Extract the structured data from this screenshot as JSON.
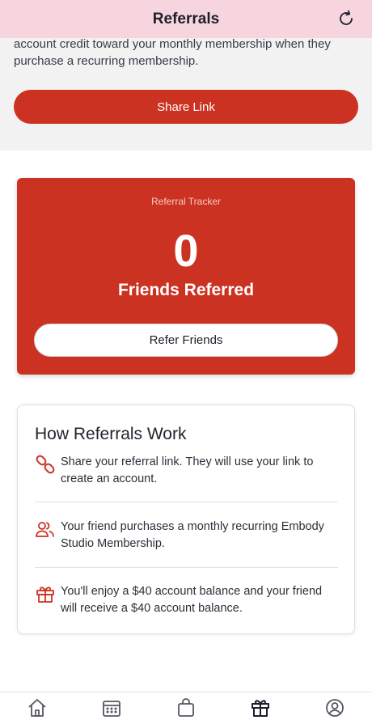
{
  "header": {
    "title": "Referrals"
  },
  "intro": {
    "text": "account credit toward your monthly membership when they purchase a recurring membership.",
    "share_label": "Share Link"
  },
  "tracker": {
    "label": "Referral Tracker",
    "count": "0",
    "count_label": "Friends Referred",
    "refer_label": "Refer Friends"
  },
  "how": {
    "title": "How Referrals Work",
    "steps": [
      {
        "icon": "link-icon",
        "text": "Share your referral link. They will use your link to create an account."
      },
      {
        "icon": "users-icon",
        "text": "Your friend purchases a monthly recurring Embody Studio Membership."
      },
      {
        "icon": "gift-icon",
        "text": "You'll enjoy a $40 account balance and your friend will receive a $40 account balance."
      }
    ]
  },
  "tabs": [
    {
      "name": "home",
      "icon": "home-icon"
    },
    {
      "name": "schedule",
      "icon": "calendar-icon"
    },
    {
      "name": "shop",
      "icon": "bag-icon"
    },
    {
      "name": "referrals",
      "icon": "gift-icon",
      "active": true
    },
    {
      "name": "profile",
      "icon": "profile-icon"
    }
  ],
  "colors": {
    "accent": "#cc3222",
    "header_bg": "#f7d5df"
  }
}
